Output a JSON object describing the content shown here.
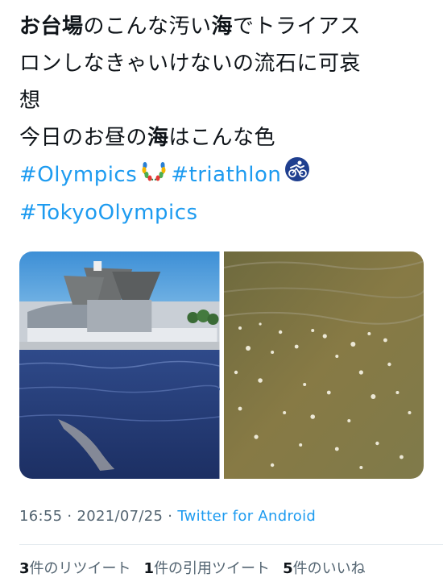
{
  "tweet": {
    "line1": {
      "bold1": "お台場",
      "text1": "のこんな汚い",
      "bold2": "海",
      "text2": "でトライアス"
    },
    "line2": "ロンしなきゃいけないの流石に可哀",
    "line3": "想",
    "line4": {
      "text1": "今日のお昼の",
      "bold1": "海",
      "text2": "はこんな色"
    },
    "hashtags": [
      "#Olympics",
      "#triathlon",
      "#TokyoOlympics"
    ]
  },
  "media": {
    "photos": [
      "tokyo-big-sight-bay-photo",
      "murky-water-closeup-photo"
    ]
  },
  "meta": {
    "time": "16:55",
    "date": "2021/07/25",
    "separator": "·",
    "source": "Twitter for Android"
  },
  "stats": {
    "retweets_count": "3",
    "retweets_label": "件のリツイート",
    "quotes_count": "1",
    "quotes_label": "件の引用ツイート",
    "likes_count": "5",
    "likes_label": "件のいいね"
  },
  "colors": {
    "link": "#1d9bf0",
    "secondary": "#536471",
    "text": "#0f1419"
  }
}
